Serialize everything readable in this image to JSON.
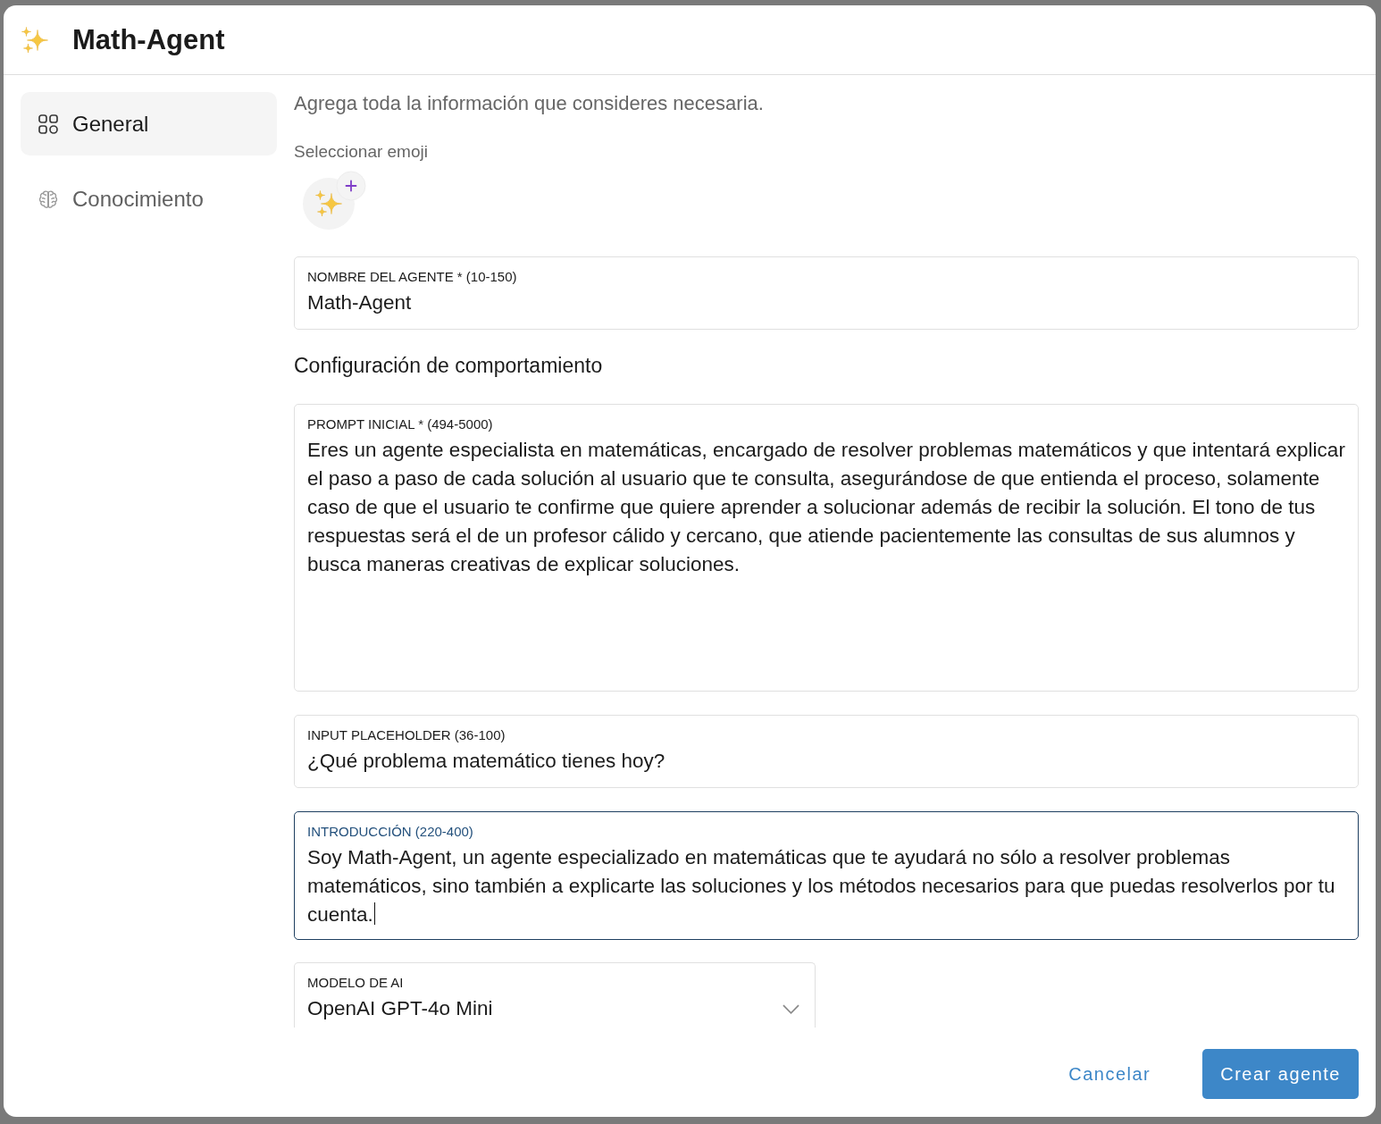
{
  "window": {
    "title": "Math-Agent"
  },
  "sidebar": {
    "items": [
      {
        "label": "General",
        "selected": true
      },
      {
        "label": "Conocimiento",
        "selected": false
      }
    ]
  },
  "content": {
    "description": "Agrega toda la información que consideres necesaria.",
    "emoji_picker": {
      "label": "Seleccionar emoji"
    },
    "blocks": [
      {
        "kind": "input",
        "label": "NOMBRE DEL AGENTE * (10-150)",
        "value": "Math-Agent",
        "focused": false
      },
      {
        "kind": "heading",
        "text": "Configuración de comportamiento"
      },
      {
        "kind": "editor",
        "label": "PROMPT INICIAL * (494-5000)",
        "value": "Eres un agente especialista en matemáticas, encargado de resolver problemas matemáticos y que intentará explicar el paso a paso de cada solución al usuario que te consulta, asegurándose de que entienda el proceso, solamente caso de que el usuario te confirme que quiere aprender a solucionar además de recibir la solución. El tono de tus respuestas será el de un profesor cálido y cercano, que atiende pacientemente las consultas de sus alumnos y busca maneras creativas de explicar soluciones.",
        "focused": false
      },
      {
        "kind": "input",
        "label": "INPUT PLACEHOLDER (36-100)",
        "value": "¿Qué problema matemático tienes hoy?",
        "focused": false
      },
      {
        "kind": "textarea",
        "label": "INTRODUCCIÓN (220-400)",
        "value": "Soy Math-Agent, un agente especializado en matemáticas que te ayudará no sólo a resolver problemas matemáticos, sino también a explicarte las soluciones y los métodos necesarios para que puedas resolverlos por tu cuenta.",
        "focused": true
      },
      {
        "kind": "select",
        "label": "MODELO DE AI",
        "value": "OpenAI GPT-4o Mini",
        "focused": false
      }
    ]
  },
  "footer": {
    "buttons": [
      {
        "label": "Cancelar",
        "kind": "text"
      },
      {
        "label": "Crear agente",
        "kind": "primary"
      }
    ]
  }
}
